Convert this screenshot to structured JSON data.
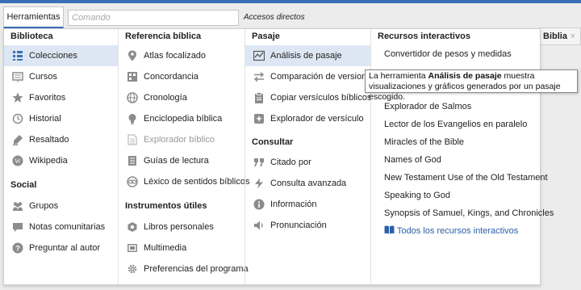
{
  "toolbar": {
    "home_tab": "Herramientas",
    "command_placeholder": "Comando",
    "shortcuts": "Accesos directos"
  },
  "background_tab": {
    "label": "Biblia",
    "close": "×"
  },
  "columns": {
    "biblioteca": {
      "header": "Biblioteca",
      "items": [
        "Colecciones",
        "Cursos",
        "Favoritos",
        "Historial",
        "Resaltado",
        "Wikipedia"
      ]
    },
    "social": {
      "header": "Social",
      "items": [
        "Grupos",
        "Notas comunitarias",
        "Preguntar al autor"
      ]
    },
    "referencia": {
      "header": "Referencia bíblica",
      "items": [
        "Atlas focalizado",
        "Concordancia",
        "Cronología",
        "Enciclopedia bíblica",
        "Explorador bíblico",
        "Guías de lectura",
        "Léxico de sentidos bíblicos"
      ]
    },
    "instrumentos": {
      "header": "Instrumentos útiles",
      "items": [
        "Libros personales",
        "Multimedia",
        "Preferencias del programa"
      ]
    },
    "pasaje": {
      "header": "Pasaje",
      "items": [
        "Análisis de pasaje",
        "Comparación de versiones",
        "Copiar versículos bíblicos",
        "Explorador de versículo"
      ]
    },
    "consultar": {
      "header": "Consultar",
      "items": [
        "Citado por",
        "Consulta avanzada",
        "Información",
        "Pronunciación"
      ]
    },
    "recursos": {
      "header": "Recursos interactivos",
      "items": [
        "Convertidor de pesos y medidas",
        "Explorador de Salmos",
        "Lector de los Evangelios en paralelo",
        "Miracles of the Bible",
        "Names of God",
        "New Testament Use of the Old Testament",
        "Speaking to God",
        "Synopsis of Samuel, Kings, and Chronicles"
      ],
      "all_link": "Todos los recursos interactivos"
    }
  },
  "tooltip": {
    "prefix": "La herramienta ",
    "tool": "Análisis de pasaje",
    "suffix": " muestra visualizaciones y gráficos generados por un pasaje escogido."
  },
  "colors": {
    "accent": "#3a6fb7",
    "selected": "#dde7f4",
    "icon": "#8c8c8c",
    "link": "#2b5fa8"
  }
}
